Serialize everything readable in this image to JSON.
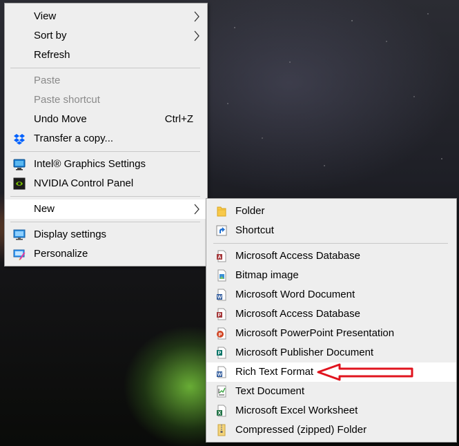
{
  "context_menu": {
    "view": "View",
    "sort_by": "Sort by",
    "refresh": "Refresh",
    "paste": "Paste",
    "paste_shortcut": "Paste shortcut",
    "undo_move": "Undo Move",
    "undo_shortcut": "Ctrl+Z",
    "transfer_copy": "Transfer a copy...",
    "intel_graphics": "Intel® Graphics Settings",
    "nvidia_panel": "NVIDIA Control Panel",
    "new": "New",
    "display_settings": "Display settings",
    "personalize": "Personalize"
  },
  "new_submenu": {
    "folder": "Folder",
    "shortcut": "Shortcut",
    "access_db_1": "Microsoft Access Database",
    "bitmap": "Bitmap image",
    "word_doc": "Microsoft Word Document",
    "access_db_2": "Microsoft Access Database",
    "powerpoint": "Microsoft PowerPoint Presentation",
    "publisher": "Microsoft Publisher Document",
    "rtf": "Rich Text Format",
    "text_doc": "Text Document",
    "excel": "Microsoft Excel Worksheet",
    "zip_folder": "Compressed (zipped) Folder"
  },
  "icons": {
    "dropbox": "dropbox-icon",
    "intel": "intel-graphics-icon",
    "nvidia": "nvidia-icon",
    "display": "display-icon",
    "personalize": "personalize-icon"
  },
  "colors": {
    "menu_bg": "#eeeeee",
    "highlight": "#ffffff",
    "annotation_arrow": "#e0141e",
    "disabled_text": "#8a8a8a"
  }
}
